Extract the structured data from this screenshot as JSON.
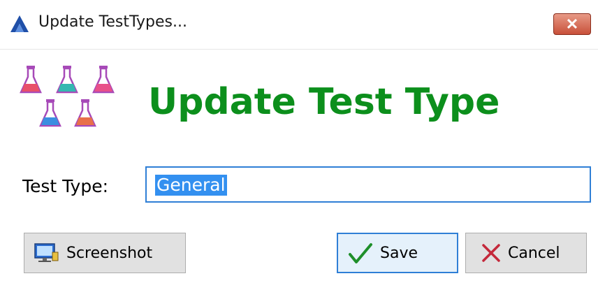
{
  "window": {
    "title": "Update TestTypes...",
    "close_label": "✕"
  },
  "header": {
    "heading": "Update Test Type",
    "logo_icon": "flasks-icon"
  },
  "form": {
    "test_type_label": "Test Type:",
    "test_type_value": "General"
  },
  "buttons": {
    "screenshot_label": "Screenshot",
    "save_label": "Save",
    "cancel_label": "Cancel"
  },
  "colors": {
    "heading": "#0c8f1c",
    "focus": "#2f7fd6",
    "selection": "#3390f0",
    "close": "#c8503a"
  }
}
